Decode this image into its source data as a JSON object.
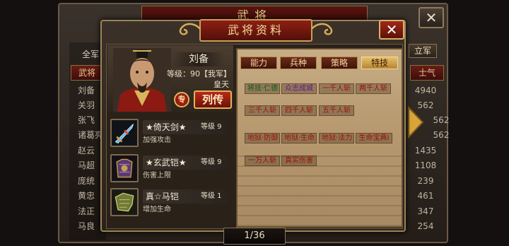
{
  "background": {
    "title": "武将",
    "close_label": "✕",
    "left_tab": "全军",
    "right_tab": "立军",
    "list_header_name": "武将",
    "list_header_value": "士气",
    "rows": [
      {
        "name": "刘备",
        "value": "4940"
      },
      {
        "name": "关羽",
        "value": "562"
      },
      {
        "name": "张飞",
        "value": "562"
      },
      {
        "name": "诸葛亮",
        "value": "562"
      },
      {
        "name": "赵云",
        "value": "1435"
      },
      {
        "name": "马超",
        "value": "1108"
      },
      {
        "name": "庞统",
        "value": "239"
      },
      {
        "name": "黄忠",
        "value": "461"
      },
      {
        "name": "法正",
        "value": "347"
      },
      {
        "name": "马良",
        "value": "254"
      }
    ]
  },
  "dialog": {
    "title": "武将资料",
    "close_label": "✕",
    "general": {
      "name": "刘备",
      "level": "等级：90【我军】",
      "title": "皇天",
      "spec_label": "专",
      "bio_label": "列传"
    },
    "equipment": [
      {
        "name": "★倚天剑★",
        "level": "等级 9",
        "desc": "加强攻击",
        "icon": "sword-icon"
      },
      {
        "name": "★玄武铠★",
        "level": "等级 9",
        "desc": "伤害上限",
        "icon": "armor-icon"
      },
      {
        "name": "真☆马铠",
        "level": "等级 1",
        "desc": "增加生命",
        "icon": "horse-armor-icon"
      }
    ],
    "tabs": [
      {
        "label": "能力",
        "active": false
      },
      {
        "label": "兵种",
        "active": false
      },
      {
        "label": "策略",
        "active": false
      },
      {
        "label": "特技",
        "active": true
      }
    ],
    "skills": [
      {
        "label": "将技·仁德",
        "color": "green"
      },
      {
        "label": "众志成城",
        "color": "purple"
      },
      {
        "label": "一千人斩",
        "color": "red"
      },
      {
        "label": "两千人斩",
        "color": "red"
      },
      {
        "label": "三千人斩",
        "color": "red"
      },
      {
        "label": "四千人斩",
        "color": "red"
      },
      {
        "label": "五千人斩",
        "color": "red"
      },
      {
        "label": "地狱·防御",
        "color": "red"
      },
      {
        "label": "地狱·生命",
        "color": "red"
      },
      {
        "label": "地狱·法力",
        "color": "red"
      },
      {
        "label": "生命宝典I",
        "color": "red"
      },
      {
        "label": "一万人斩",
        "color": "red"
      },
      {
        "label": "真实伤害",
        "color": "red"
      }
    ],
    "page_indicator": "1/36"
  },
  "colors": {
    "accent_gold": "#e0b457",
    "title_red": "#8e1f14",
    "skill_red": "#9a1308",
    "skill_green": "#0c5a14",
    "skill_purple": "#5a1a8a"
  }
}
